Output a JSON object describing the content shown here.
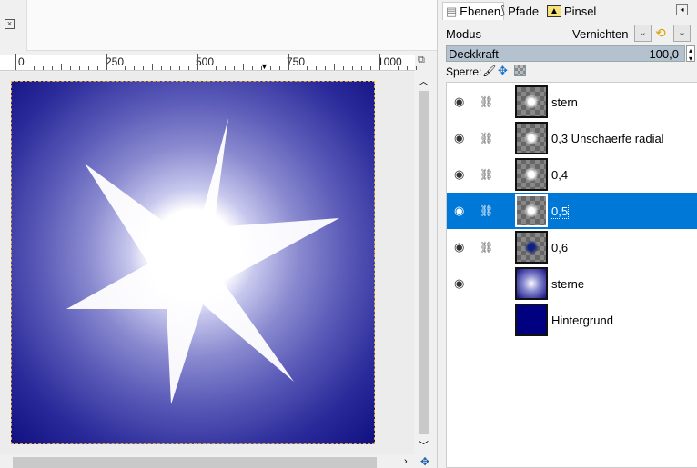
{
  "canvas": {
    "close_icon": "close-icon",
    "ruler_labels": [
      "0",
      "250",
      "500",
      "750",
      "1000"
    ]
  },
  "panel": {
    "tabs": [
      {
        "label": "Ebenen"
      },
      {
        "label": "Pfade"
      },
      {
        "label": "Pinsel"
      }
    ],
    "mode_label": "Modus",
    "mode_value": "Vernichten",
    "opacity_label": "Deckkraft",
    "opacity_value": "100,0",
    "lock_label": "Sperre:",
    "layers": [
      {
        "name": "stern",
        "visible": true,
        "chained": true,
        "selected": false
      },
      {
        "name": "0,3 Unschaerfe radial",
        "visible": true,
        "chained": true,
        "selected": false
      },
      {
        "name": "0,4",
        "visible": true,
        "chained": true,
        "selected": false
      },
      {
        "name": "0,5",
        "visible": true,
        "chained": true,
        "selected": true
      },
      {
        "name": "0,6",
        "visible": true,
        "chained": true,
        "selected": false
      },
      {
        "name": "sterne",
        "visible": true,
        "chained": false,
        "selected": false
      },
      {
        "name": "Hintergrund",
        "visible": false,
        "chained": false,
        "selected": false
      }
    ]
  },
  "colors": {
    "selection": "#0078d7",
    "image_dark": "#101080"
  }
}
